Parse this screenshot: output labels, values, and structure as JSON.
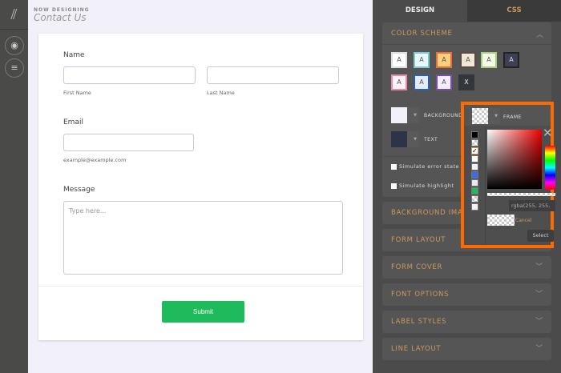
{
  "header": {
    "now_designing": "NOW DESIGNING",
    "form_title": "Contact Us"
  },
  "form": {
    "name_label": "Name",
    "first_name": "First Name",
    "last_name": "Last Name",
    "email_label": "Email",
    "email_hint": "example@example.com",
    "message_label": "Message",
    "message_placeholder": "Type here...",
    "submit": "Submit"
  },
  "panel": {
    "tabs": [
      "DESIGN",
      "CSS"
    ],
    "color_scheme": "COLOR SCHEME",
    "schemes": [
      "A",
      "A",
      "A",
      "A",
      "A",
      "A",
      "A",
      "A",
      "A",
      "X"
    ],
    "background_label": "BACKGROUND",
    "text_label": "TEXT",
    "frame_label": "FRAME",
    "simulate_error": "Simulate error state",
    "simulate_highlight": "Simulate highlight",
    "sections": [
      "BACKGROUND IMAGE",
      "FORM LAYOUT",
      "FORM COVER",
      "FONT OPTIONS",
      "LABEL STYLES",
      "LINE LAYOUT"
    ],
    "picker": {
      "value": "rgba(255, 255,",
      "cancel": "Cancel",
      "select": "Select"
    }
  },
  "colors": {
    "accent": "#c99a5c",
    "submit": "#1fba5b",
    "highlight": "#ff6a00"
  }
}
